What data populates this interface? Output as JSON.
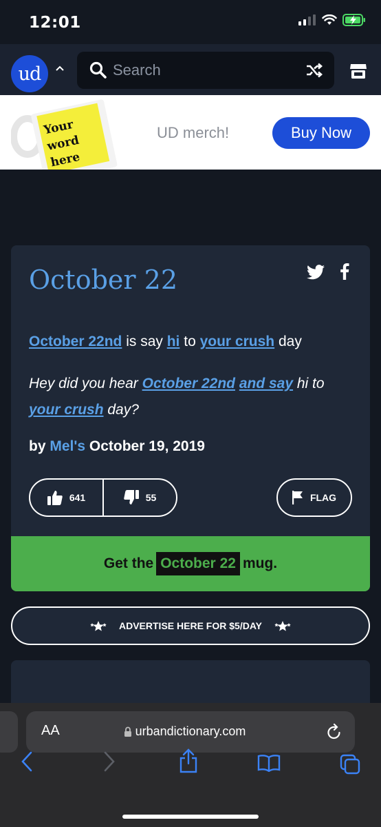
{
  "status_bar": {
    "time": "12:01"
  },
  "header": {
    "logo_text": "ud",
    "search": {
      "placeholder": "Search",
      "value": ""
    }
  },
  "banner": {
    "mug_text": "Your word here",
    "mug_text_lines": [
      "Your",
      "word",
      "here"
    ],
    "merch_text": "UD merch!",
    "buy_label": "Buy Now"
  },
  "definition": {
    "word": "October 22",
    "meaning": {
      "link1": "October 22nd",
      "text1": " is say ",
      "link2": "hi",
      "text2": " to ",
      "link3": "your crush",
      "text3": " day"
    },
    "example": {
      "text1": "Hey did you hear ",
      "link1": "October 22nd",
      "text2": " ",
      "link2": "and say",
      "text3": " hi to ",
      "link3": "your crush",
      "text4": " day?"
    },
    "byline": {
      "prefix": "by ",
      "author": "Mel's",
      "date": " October 19, 2019"
    },
    "upvotes": "641",
    "downvotes": "55",
    "flag_label": "FLAG",
    "mug_cta": {
      "prefix": "Get the",
      "word": "October 22",
      "suffix": "mug."
    }
  },
  "advertise_label": "ADVERTISE HERE FOR $5/DAY",
  "safari": {
    "aa_label": "AA",
    "url": "urbandictionary.com"
  },
  "colors": {
    "background": "#131821",
    "card": "#1f2837",
    "link": "#5aa0e6",
    "brand_blue": "#1d4ed8",
    "mug_green": "#4cae4c"
  }
}
